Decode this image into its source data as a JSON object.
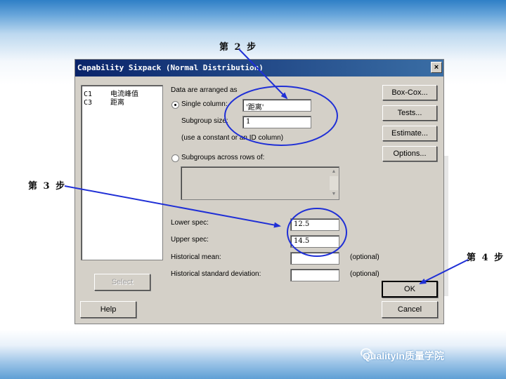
{
  "dialog": {
    "title": "Capability Sixpack (Normal Distribution)",
    "close_glyph": "×",
    "variables": [
      {
        "col": "C1",
        "name": "电流峰值"
      },
      {
        "col": "C3",
        "name": "距离"
      }
    ],
    "data_arranged_label": "Data are arranged as",
    "single_column_label": "Single column:",
    "single_column_value": "'距离'",
    "subgroup_size_label": "Subgroup size:",
    "subgroup_size_value": "1",
    "subgroup_hint": "(use a constant or an ID column)",
    "subgroups_across_label": "Subgroups across rows of:",
    "subgroups_across_value": "",
    "lower_spec_label": "Lower spec:",
    "lower_spec_value": "12.5",
    "upper_spec_label": "Upper spec:",
    "upper_spec_value": "14.5",
    "hist_mean_label": "Historical mean:",
    "hist_mean_value": "",
    "hist_sd_label": "Historical standard deviation:",
    "hist_sd_value": "",
    "optional_1": "(optional)",
    "optional_2": "(optional)",
    "buttons": {
      "boxcox": "Box-Cox...",
      "tests": "Tests...",
      "estimate": "Estimate...",
      "options": "Options...",
      "ok": "OK",
      "cancel": "Cancel",
      "select": "Select",
      "help": "Help"
    }
  },
  "annotations": {
    "step2": "第 2 步",
    "step3": "第 3 步",
    "step4": "第 4 步",
    "color": "#1f2fd6"
  },
  "watermark": "QualityIn质量学院",
  "icons": {
    "close": "close-icon",
    "radio": "radio-icon",
    "scroll_up": "scroll-up-arrow-icon",
    "scroll_down": "scroll-down-arrow-icon",
    "watermark": "wechat-logo-icon"
  }
}
